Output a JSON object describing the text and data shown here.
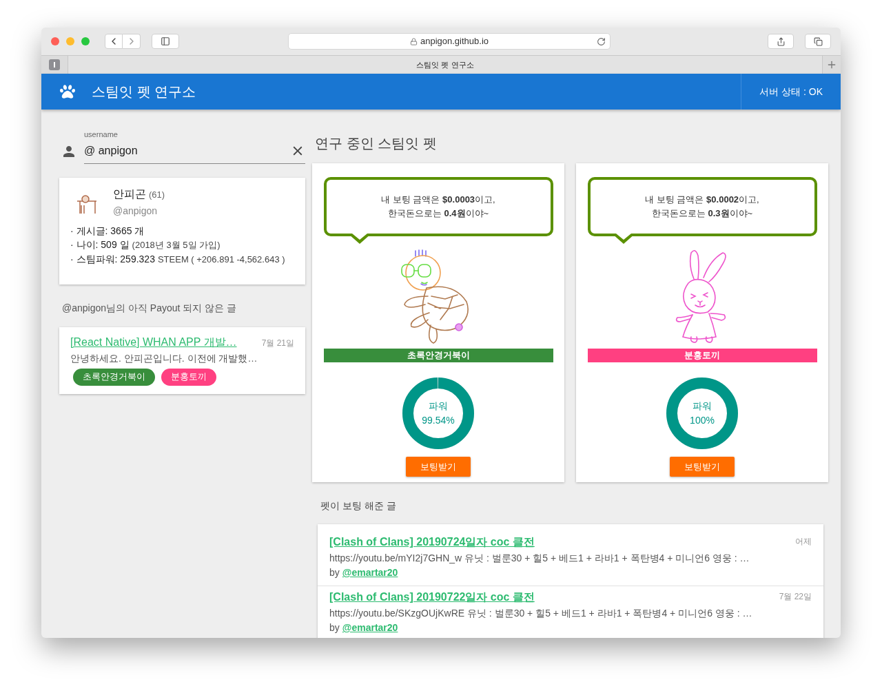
{
  "browser": {
    "url": "anpigon.github.io",
    "tab_title": "스팀잇 펫 연구소"
  },
  "header": {
    "title": "스팀잇 펫 연구소",
    "server_status": "서버 상태 : OK"
  },
  "search": {
    "label": "username",
    "value": "@ anpigon"
  },
  "profile": {
    "name": "안피곤",
    "reputation": "(61)",
    "handle": "@anpigon",
    "stats": [
      {
        "main": "· 게시글: 3665 개"
      },
      {
        "main": "· 나이: 509 일",
        "note": "(2018년 3월 5일 가입)"
      },
      {
        "main": "· 스팀파워: 259.323",
        "note": "STEEM ( +206.891 -4,562.643 )"
      }
    ]
  },
  "pending": {
    "heading": "@anpigon님의 아직 Payout 되지 않은 글",
    "posts": [
      {
        "title": "[React Native] WHAN APP 개발…",
        "date": "7월 21일",
        "excerpt": "안녕하세요. 안피곤입니다. 이전에 개발했…",
        "tags": [
          {
            "label": "초록안경거북이",
            "color": "#388e3c"
          },
          {
            "label": "분홍토끼",
            "color": "#ff4081"
          }
        ]
      }
    ]
  },
  "pets_heading": "연구 중인 스팀잇 펫",
  "pets": [
    {
      "kind": "turtle",
      "bubble_lines": [
        "내 보팅 금액은 **$0.0003**이고,",
        "한국돈으로는 **0.4원**이야~"
      ],
      "name": "초록안경거북이",
      "color": "#388e3c",
      "power_label": "파워",
      "power_value": "99.54%",
      "level": 0.9954,
      "button": "보팅받기"
    },
    {
      "kind": "rabbit",
      "bubble_lines": [
        "내 보팅 금액은 **$0.0002**이고,",
        "한국돈으로는 **0.3원**이야~"
      ],
      "name": "분홍토끼",
      "color": "#ff4081",
      "power_label": "파워",
      "power_value": "100%",
      "level": 1,
      "button": "보팅받기"
    }
  ],
  "voted": {
    "heading": "펫이 보팅 해준 글",
    "posts": [
      {
        "title": "[Clash of Clans] 20190724일자 coc 클전",
        "excerpt": "https://youtu.be/mYI2j7GHN_w 유닛 : 벌룬30 + 힐5 + 베드1 + 라바1 + 폭탄병4 + 미니언6 영웅 : …",
        "by": "by",
        "author": "@emartar20",
        "date": "어제"
      },
      {
        "title": "[Clash of Clans] 20190722일자 coc 클전",
        "excerpt": "https://youtu.be/SKzgOUjKwRE 유닛 : 벌룬30 + 힐5 + 베드1 + 라바1 + 폭탄병4 + 미니언6 영웅 : …",
        "by": "by",
        "author": "@emartar20",
        "date": "7월 22일"
      }
    ]
  }
}
